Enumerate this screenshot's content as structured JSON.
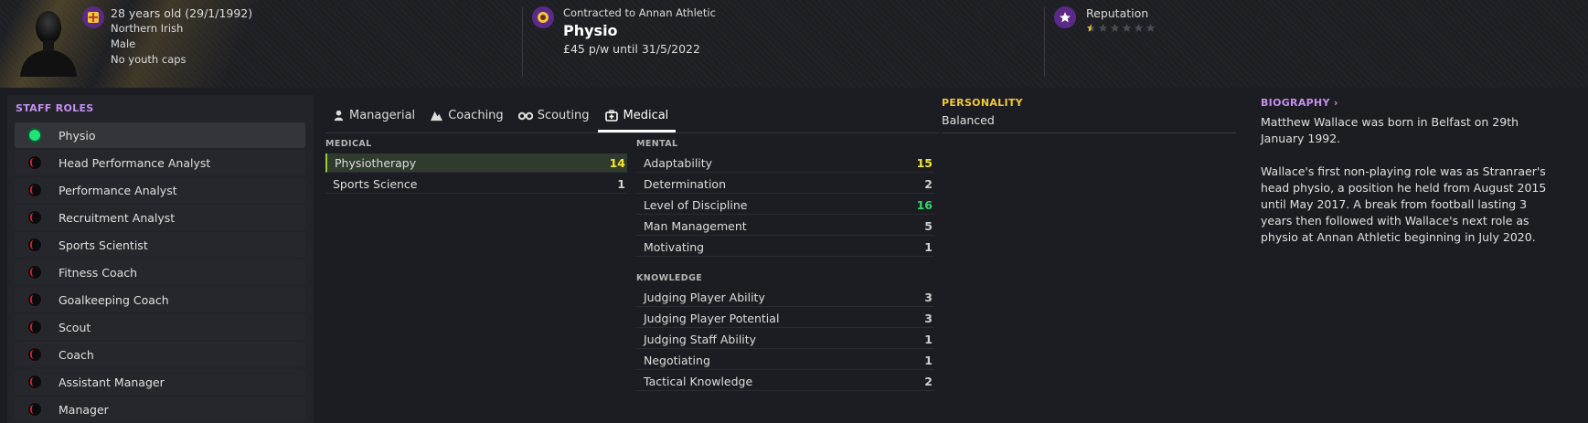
{
  "header": {
    "age": "28 years old (29/1/1992)",
    "nationality": "Northern Irish",
    "gender": "Male",
    "youth_caps": "No youth caps",
    "contract": "Contracted to Annan Athletic",
    "role": "Physio",
    "wage": "£45 p/w until 31/5/2022",
    "reputation_label": "Reputation",
    "reputation_stars": 0.5,
    "reputation_max": 6
  },
  "roles": {
    "title": "STAFF ROLES",
    "items": [
      {
        "label": "Physio",
        "active": true
      },
      {
        "label": "Head Performance Analyst",
        "active": false
      },
      {
        "label": "Performance Analyst",
        "active": false
      },
      {
        "label": "Recruitment Analyst",
        "active": false
      },
      {
        "label": "Sports Scientist",
        "active": false
      },
      {
        "label": "Fitness Coach",
        "active": false
      },
      {
        "label": "Goalkeeping Coach",
        "active": false
      },
      {
        "label": "Scout",
        "active": false
      },
      {
        "label": "Coach",
        "active": false
      },
      {
        "label": "Assistant Manager",
        "active": false
      },
      {
        "label": "Manager",
        "active": false
      }
    ]
  },
  "tabs": [
    {
      "label": "Managerial",
      "icon": "managerial-icon"
    },
    {
      "label": "Coaching",
      "icon": "coaching-icon"
    },
    {
      "label": "Scouting",
      "icon": "binoculars-icon"
    },
    {
      "label": "Medical",
      "icon": "medical-kit-icon",
      "active": true
    }
  ],
  "medical": {
    "title": "MEDICAL",
    "attrs": [
      {
        "name": "Physiotherapy",
        "value": "14"
      },
      {
        "name": "Sports Science",
        "value": "1"
      }
    ]
  },
  "mental": {
    "title": "MENTAL",
    "attrs": [
      {
        "name": "Adaptability",
        "value": "15"
      },
      {
        "name": "Determination",
        "value": "2"
      },
      {
        "name": "Level of Discipline",
        "value": "16"
      },
      {
        "name": "Man Management",
        "value": "5"
      },
      {
        "name": "Motivating",
        "value": "1"
      }
    ]
  },
  "knowledge": {
    "title": "KNOWLEDGE",
    "attrs": [
      {
        "name": "Judging Player Ability",
        "value": "3"
      },
      {
        "name": "Judging Player Potential",
        "value": "3"
      },
      {
        "name": "Judging Staff Ability",
        "value": "1"
      },
      {
        "name": "Negotiating",
        "value": "1"
      },
      {
        "name": "Tactical Knowledge",
        "value": "2"
      }
    ]
  },
  "personality": {
    "title": "PERSONALITY",
    "value": "Balanced"
  },
  "biography": {
    "title": "BIOGRAPHY",
    "p1": "Matthew Wallace was born in Belfast on 29th January 1992.",
    "p2": "Wallace's first non-playing role was as Stranraer's head physio, a position he held from August 2015 until May 2017. A break from football lasting 3 years then followed with Wallace's next role as physio at Annan Athletic beginning in July 2020."
  },
  "colors": {
    "accent_purple": "#c58ff0",
    "active_role": "#22e07a",
    "inactive_role": "#d0202a",
    "high_value_yellow": "#f5e63a",
    "high_value_green": "#34d96b"
  }
}
